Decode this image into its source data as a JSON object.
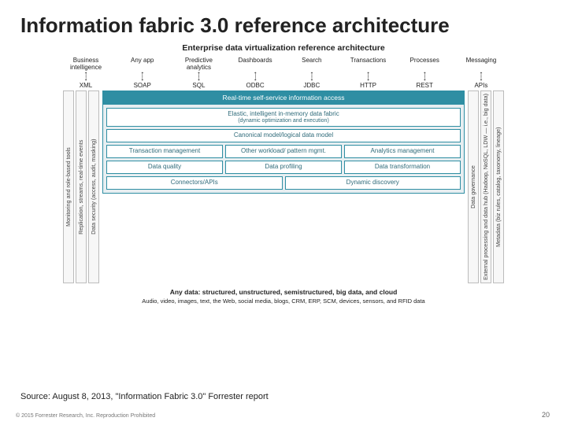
{
  "title": "Information fabric 3.0 reference architecture",
  "diagram": {
    "heading": "Enterprise data virtualization reference architecture",
    "consumers": [
      "Business intelligence",
      "Any app",
      "Predictive analytics",
      "Dashboards",
      "Search",
      "Transactions",
      "Processes",
      "Messaging"
    ],
    "protocols": [
      "XML",
      "SOAP",
      "SQL",
      "ODBC",
      "JDBC",
      "HTTP",
      "REST",
      "APIs"
    ],
    "left_strips": [
      "Monitoring and role-based tools",
      "Replication, streams, real-time events",
      "Data security (access, audit, masking)"
    ],
    "right_strips": [
      "Data governance",
      "External processing and data hub (Hadoop, NoSQL, LDW — i.e., big data)",
      "Metadata (biz rules, catalog, taxonomy, lineage)"
    ],
    "core": {
      "header": "Real-time self-service information access",
      "elastic": "Elastic, intelligent in-memory data fabric",
      "elastic_sub": "(dynamic optimization and execution)",
      "canonical": "Canonical model/logical data model",
      "mgmt_row": [
        "Transaction management",
        "Other workload/ pattern mgmt.",
        "Analytics management"
      ],
      "quality_row": [
        "Data quality",
        "Data profiling",
        "Data transformation"
      ],
      "connector_row": [
        "Connectors/APIs",
        "Dynamic discovery"
      ]
    },
    "anydata_title": "Any data: structured, unstructured, semistructured, big data, and cloud",
    "anydata_sub": "Audio, video, images, text, the Web, social media, blogs, CRM, ERP, SCM, devices, sensors, and RFID data"
  },
  "source": "Source: August 8, 2013, \"Information Fabric 3.0\" Forrester report",
  "footer": "© 2015 Forrester Research, Inc. Reproduction Prohibited",
  "pagenum": "20"
}
